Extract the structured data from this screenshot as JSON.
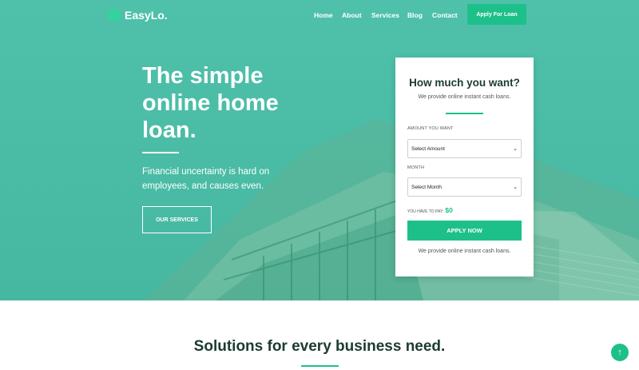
{
  "brand": {
    "name": "EasyLo.",
    "icon": "logo-icon"
  },
  "nav": {
    "items": [
      {
        "label": "Home"
      },
      {
        "label": "About"
      },
      {
        "label": "Services"
      },
      {
        "label": "Blog"
      },
      {
        "label": "Contact"
      }
    ],
    "cta_label": "Apply For Loan"
  },
  "hero": {
    "title": "The simple\nonline home\nloan.",
    "subtitle": "Financial uncertainty is hard on\nemployees, and causes even.",
    "button_label": "OUR SERVICES"
  },
  "loan_card": {
    "title": "How much you want?",
    "subtitle": "We provide online instant cash loans.",
    "amount_label": "AMOUNT YOU WANT",
    "amount_value": "Select Amount",
    "month_label": "MONTH",
    "month_value": "Select Month",
    "pay_label": "YOU HAVE TO PAY:",
    "pay_value": "$0",
    "submit_label": "APPLY NOW",
    "footer_text": "We provide online instant cash loans."
  },
  "section": {
    "title": "Solutions for every business need."
  },
  "scroll_top": {
    "icon": "arrow-up-icon",
    "glyph": "↑"
  },
  "colors": {
    "accent": "#1ec089",
    "hero_bg": "#4fc1ab",
    "heading": "#1c3b31"
  }
}
